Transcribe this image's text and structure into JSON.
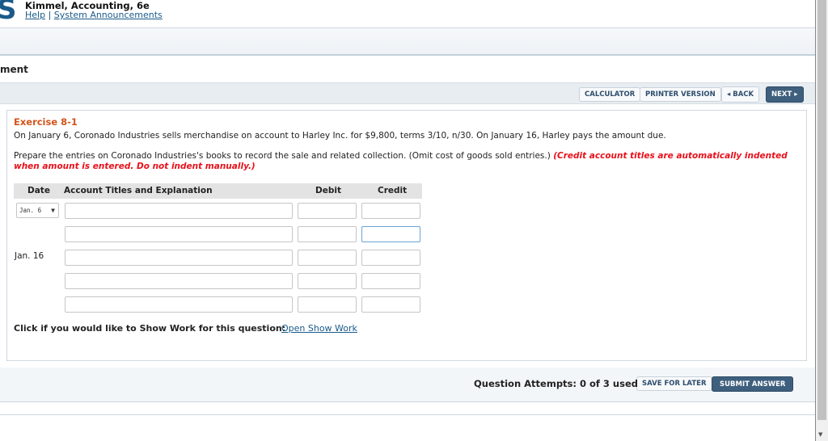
{
  "header": {
    "logo": "S",
    "book_title": "Kimmel, Accounting, 6e",
    "help": "Help",
    "separator": "|",
    "announcements": "System Announcements"
  },
  "page_title": "ment",
  "toolbar": {
    "calculator": "CALCULATOR",
    "printer": "PRINTER VERSION",
    "back": "BACK",
    "next": "NEXT"
  },
  "question": {
    "title": "Exercise 8-1",
    "text": "On January 6, Coronado Industries sells merchandise on account to Harley Inc. for $9,800, terms 3/10, n/30. On January 16, Harley pays the amount due.",
    "instruction": "Prepare the entries on Coronado Industries's books to record the sale and related collection. (Omit cost of goods sold entries.) ",
    "note": "(Credit account titles are automatically indented when amount is entered. Do not indent manually.)"
  },
  "table": {
    "headers": {
      "date": "Date",
      "account": "Account Titles and Explanation",
      "debit": "Debit",
      "credit": "Credit"
    },
    "date_select": "Jan. 6",
    "date_label_2": "Jan. 16",
    "rows": [
      {
        "account": "",
        "debit": "",
        "credit": ""
      },
      {
        "account": "",
        "debit": "",
        "credit": ""
      },
      {
        "account": "",
        "debit": "",
        "credit": ""
      },
      {
        "account": "",
        "debit": "",
        "credit": ""
      },
      {
        "account": "",
        "debit": "",
        "credit": ""
      }
    ]
  },
  "show_work": {
    "label": "Click if you would like to Show Work for this question:",
    "link": "Open Show Work"
  },
  "footer": {
    "attempts": "Question Attempts: 0 of 3 used",
    "save": "SAVE FOR LATER",
    "submit": "SUBMIT ANSWER"
  },
  "colors": {
    "accent": "#3e5f7d",
    "exercise_title": "#d2541c",
    "note": "#e8101a",
    "link": "#1a5a8a"
  }
}
